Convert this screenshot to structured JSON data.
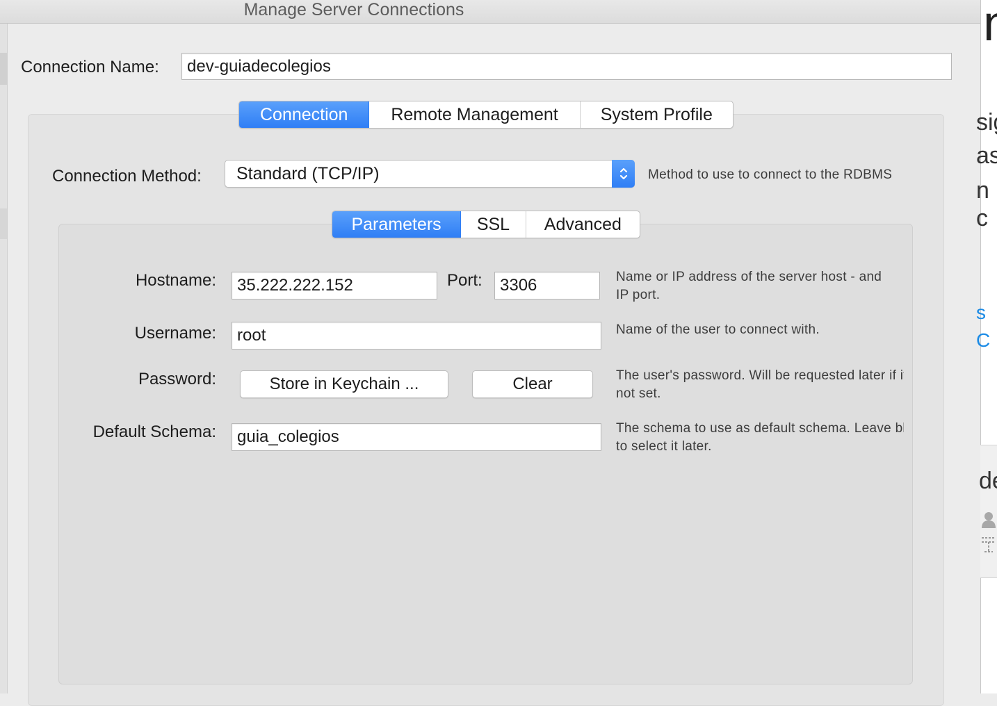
{
  "window": {
    "title": "Manage Server Connections"
  },
  "connection_name": {
    "label": "Connection Name:",
    "value": "dev-guiadecolegios"
  },
  "main_tabs": [
    {
      "label": "Connection",
      "active": true
    },
    {
      "label": "Remote Management",
      "active": false
    },
    {
      "label": "System Profile",
      "active": false
    }
  ],
  "connection_method": {
    "label": "Connection Method:",
    "value": "Standard (TCP/IP)",
    "description": "Method to use to connect to the RDBMS"
  },
  "sub_tabs": [
    {
      "label": "Parameters",
      "active": true
    },
    {
      "label": "SSL",
      "active": false
    },
    {
      "label": "Advanced",
      "active": false
    }
  ],
  "parameters": {
    "hostname": {
      "label": "Hostname:",
      "value": "35.222.222.152",
      "description_line1": "Name or IP address of the server host - and",
      "description_line2": "IP port."
    },
    "port": {
      "label": "Port:",
      "value": "3306"
    },
    "username": {
      "label": "Username:",
      "value": "root",
      "description": "Name of the user to connect with."
    },
    "password": {
      "label": "Password:",
      "store_button": "Store in Keychain ...",
      "clear_button": "Clear",
      "description_line1": "The user's password. Will be requested later if it's",
      "description_line2": "not set."
    },
    "default_schema": {
      "label": "Default Schema:",
      "value": "guia_colegios",
      "description_line1": "The schema to use as default schema. Leave blank",
      "description_line2": "to select it later."
    }
  },
  "background_window": {
    "heading_fragment": "n",
    "line1": "sig",
    "line2": "as",
    "line3": "n c",
    "link_fragment": "s C",
    "section_fragment": "de"
  },
  "colors": {
    "accent": "#2f7ef5",
    "background": "#ececec",
    "link": "#1a8ae5"
  }
}
